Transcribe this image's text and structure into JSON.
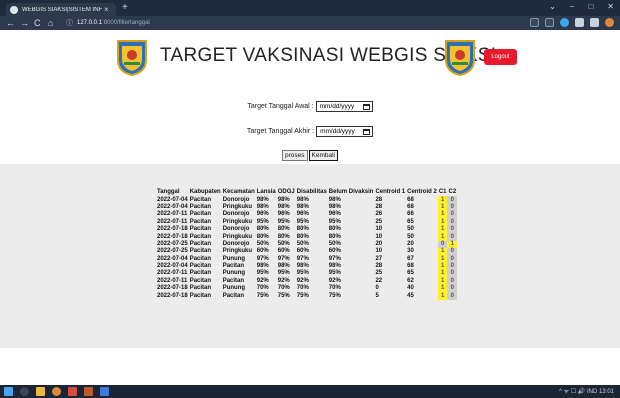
{
  "browser": {
    "tab_title": "WEBGIS SIAKSI|SISTEM INFORM",
    "tab_close": "×",
    "new_tab": "+",
    "url_host": "127.0.0.1",
    "url_path": ":8000/filtertanggal",
    "nav_back": "←",
    "nav_forward": "→",
    "nav_reload": "C",
    "nav_home": "⌂",
    "info_icon": "ⓘ",
    "win_min": "−",
    "win_max": "□",
    "win_close": "✕",
    "win_chevron": "⌄"
  },
  "header": {
    "title": "TARGET VAKSINASI WEBGIS SIAKSI",
    "logout_label": "Logout"
  },
  "form": {
    "start_label": "Target Tanggal Awal :",
    "end_label": "Target Tanggal Akhir :",
    "start_placeholder": "mm/dd/yyyy",
    "end_placeholder": "mm/dd/yyyy",
    "process_label": "proses",
    "back_label": "Kembali"
  },
  "table": {
    "headers": [
      "Tanggal",
      "Kabupaten",
      "Kecamatan",
      "Lansia",
      "ODGJ",
      "Disabilitas",
      "Belum Divaksin",
      "Centroid 1",
      "Centroid 2",
      "C1",
      "C2"
    ],
    "rows": [
      [
        "2022-07-04",
        "Pacitan",
        "Donorojo",
        "98%",
        "98%",
        "98%",
        "98%",
        "28",
        "68",
        "1",
        "0"
      ],
      [
        "2022-07-04",
        "Pacitan",
        "Pringkuku",
        "98%",
        "98%",
        "98%",
        "98%",
        "28",
        "68",
        "1",
        "0"
      ],
      [
        "2022-07-11",
        "Pacitan",
        "Donorojo",
        "96%",
        "96%",
        "96%",
        "96%",
        "26",
        "66",
        "1",
        "0"
      ],
      [
        "2022-07-11",
        "Pacitan",
        "Pringkuku",
        "95%",
        "95%",
        "95%",
        "95%",
        "25",
        "65",
        "1",
        "0"
      ],
      [
        "2022-07-18",
        "Pacitan",
        "Donorojo",
        "80%",
        "80%",
        "80%",
        "80%",
        "10",
        "50",
        "1",
        "0"
      ],
      [
        "2022-07-18",
        "Pacitan",
        "Pringkuku",
        "80%",
        "80%",
        "80%",
        "80%",
        "10",
        "50",
        "1",
        "0"
      ],
      [
        "2022-07-25",
        "Pacitan",
        "Donorojo",
        "50%",
        "50%",
        "50%",
        "50%",
        "20",
        "20",
        "0",
        "1"
      ],
      [
        "2022-07-25",
        "Pacitan",
        "Pringkuku",
        "60%",
        "60%",
        "60%",
        "60%",
        "10",
        "30",
        "1",
        "0"
      ],
      [
        "2022-07-04",
        "Pacitan",
        "Punung",
        "97%",
        "97%",
        "97%",
        "97%",
        "27",
        "67",
        "1",
        "0"
      ],
      [
        "2022-07-04",
        "Pacitan",
        "Pacitan",
        "98%",
        "98%",
        "98%",
        "98%",
        "28",
        "68",
        "1",
        "0"
      ],
      [
        "2022-07-11",
        "Pacitan",
        "Punung",
        "95%",
        "95%",
        "95%",
        "95%",
        "25",
        "65",
        "1",
        "0"
      ],
      [
        "2022-07-11",
        "Pacitan",
        "Pacitan",
        "92%",
        "92%",
        "92%",
        "92%",
        "22",
        "62",
        "1",
        "0"
      ],
      [
        "2022-07-18",
        "Pacitan",
        "Punung",
        "70%",
        "70%",
        "70%",
        "70%",
        "0",
        "40",
        "1",
        "0"
      ],
      [
        "2022-07-18",
        "Pacitan",
        "Pacitan",
        "75%",
        "75%",
        "75%",
        "75%",
        "5",
        "45",
        "1",
        "0"
      ]
    ]
  },
  "taskbar": {
    "tray_text": "^ ᯤ ☐ 🔊 IND 13:01"
  },
  "colors": {
    "accent_logout": "#e8192c",
    "yellow_cell": "#fff12a",
    "grey_cell": "#cfcfcf"
  }
}
